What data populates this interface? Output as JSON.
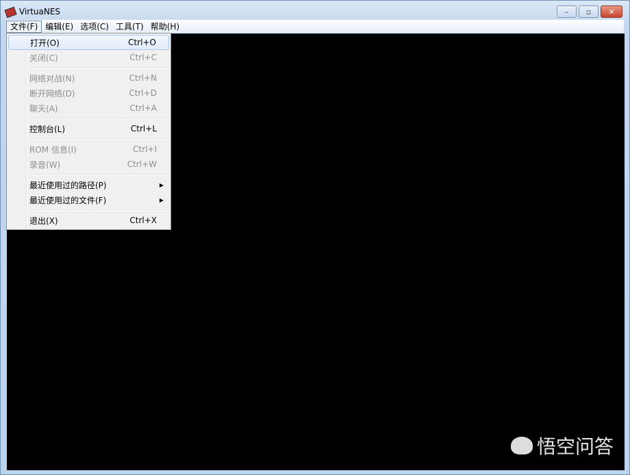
{
  "window": {
    "title": "VirtuaNES",
    "minimize": "–",
    "maximize": "▫",
    "close": "✕"
  },
  "menubar": [
    "文件(F)",
    "编辑(E)",
    "选项(C)",
    "工具(T)",
    "帮助(H)"
  ],
  "file_menu": [
    {
      "label": "打开(O)",
      "shortcut": "Ctrl+O",
      "enabled": true,
      "highlighted": true
    },
    {
      "label": "关闭(C)",
      "shortcut": "Ctrl+C",
      "enabled": false
    },
    {
      "sep": true
    },
    {
      "label": "网络对战(N)",
      "shortcut": "Ctrl+N",
      "enabled": false
    },
    {
      "label": "断开网络(D)",
      "shortcut": "Ctrl+D",
      "enabled": false
    },
    {
      "label": "聊天(A)",
      "shortcut": "Ctrl+A",
      "enabled": false
    },
    {
      "sep": true
    },
    {
      "label": "控制台(L)",
      "shortcut": "Ctrl+L",
      "enabled": true
    },
    {
      "sep": true
    },
    {
      "label": "ROM 信息(I)",
      "shortcut": "Ctrl+I",
      "enabled": false
    },
    {
      "label": "录音(W)",
      "shortcut": "Ctrl+W",
      "enabled": false
    },
    {
      "sep": true
    },
    {
      "label": "最近使用过的路径(P)",
      "shortcut": "",
      "enabled": true,
      "submenu": true
    },
    {
      "label": "最近使用过的文件(F)",
      "shortcut": "",
      "enabled": true,
      "submenu": true
    },
    {
      "sep": true
    },
    {
      "label": "退出(X)",
      "shortcut": "Ctrl+X",
      "enabled": true
    }
  ],
  "watermark": "悟空问答"
}
